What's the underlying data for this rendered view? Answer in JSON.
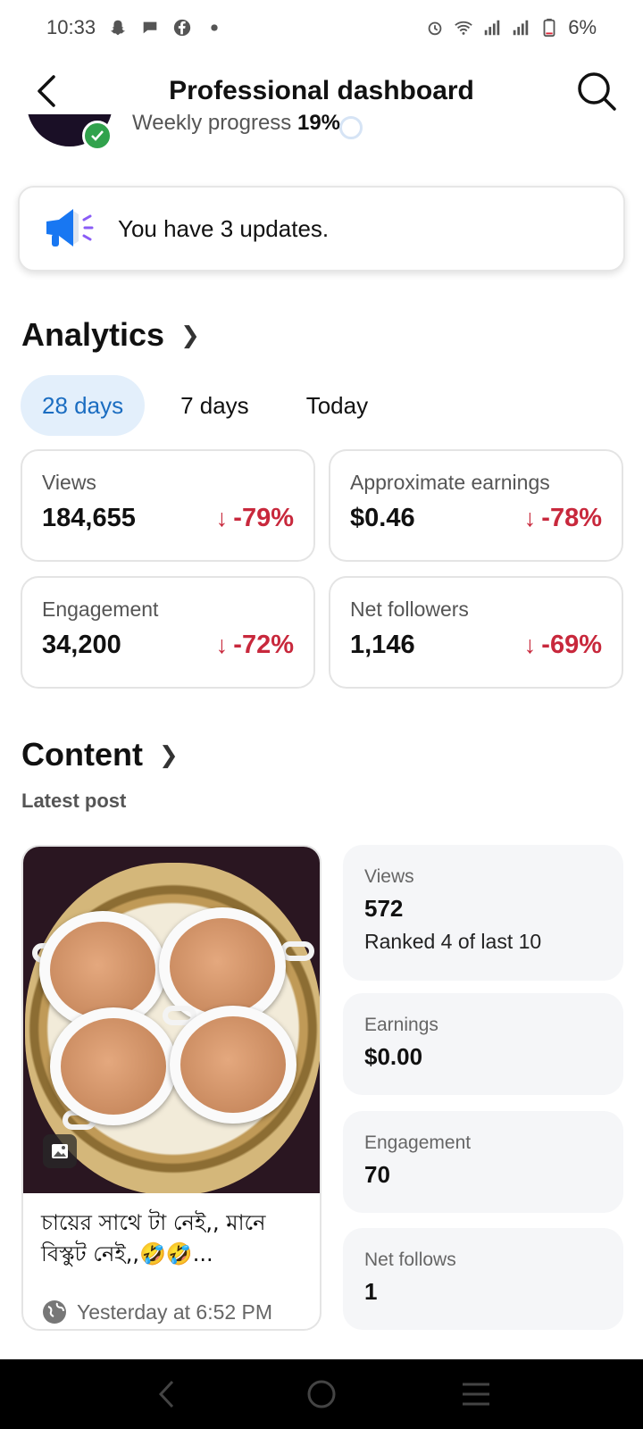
{
  "status_bar": {
    "time": "10:33",
    "battery": "6%",
    "icons": [
      "snapchat-icon",
      "chat-icon",
      "facebook-icon",
      "dot-icon",
      "alarm-icon",
      "wifi-icon",
      "signal-icon",
      "signal-icon",
      "battery-icon"
    ]
  },
  "header": {
    "title": "Professional dashboard",
    "back_icon": "back-arrow-icon",
    "search_icon": "search-icon"
  },
  "progress": {
    "label": "Weekly progress",
    "value": "19%"
  },
  "updates": {
    "text": "You have 3 updates.",
    "icon": "megaphone-icon"
  },
  "analytics": {
    "title": "Analytics",
    "tabs": [
      {
        "label": "28 days",
        "active": true
      },
      {
        "label": "7 days",
        "active": false
      },
      {
        "label": "Today",
        "active": false
      }
    ],
    "metrics": [
      {
        "label": "Views",
        "value": "184,655",
        "change": "-79%"
      },
      {
        "label": "Approximate earnings",
        "value": "$0.46",
        "change": "-78%"
      },
      {
        "label": "Engagement",
        "value": "34,200",
        "change": "-72%"
      },
      {
        "label": "Net followers",
        "value": "1,146",
        "change": "-69%"
      }
    ]
  },
  "content": {
    "title": "Content",
    "subtitle": "Latest post",
    "post": {
      "caption": "চায়ের সাথে টা নেই,, মানে বিস্কুট নেই,,🤣🤣...",
      "timestamp": "Yesterday at 6:52 PM",
      "privacy_icon": "globe-icon",
      "type_icon": "photo-icon"
    },
    "stats": [
      {
        "label": "Views",
        "value": "572",
        "sub": "Ranked 4 of last 10"
      },
      {
        "label": "Earnings",
        "value": "$0.00"
      },
      {
        "label": "Engagement",
        "value": "70"
      },
      {
        "label": "Net follows",
        "value": "1"
      }
    ]
  },
  "colors": {
    "accent": "#1b6dc1",
    "tab_active_bg": "#e3effb",
    "negative": "#c8283c",
    "verified": "#31a24c"
  }
}
